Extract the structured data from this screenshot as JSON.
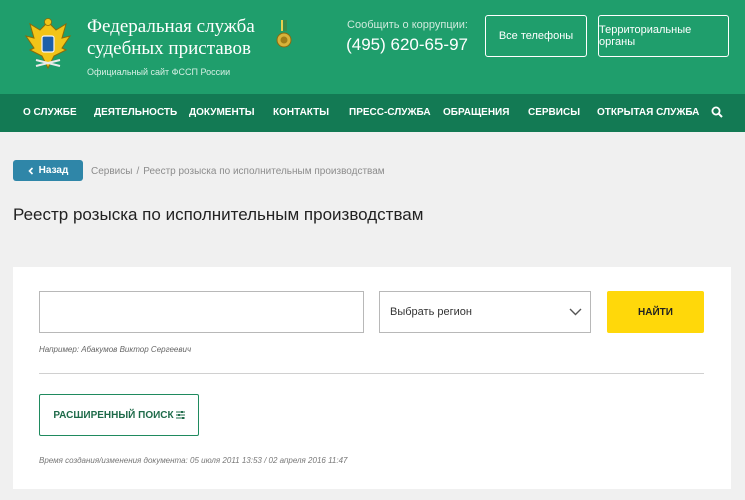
{
  "header": {
    "title_line1": "Федеральная служба",
    "title_line2": "судебных приставов",
    "subtitle": "Официальный сайт ФССП России",
    "corruption_label": "Сообщить о коррупции:",
    "corruption_phone": "(495) 620-65-97",
    "phones_button": "Все телефоны",
    "territorial_button": "Территориальные органы",
    "colors": {
      "primary": "#1f9e6c",
      "nav": "#137a54"
    }
  },
  "nav": {
    "items": [
      "О СЛУЖБЕ",
      "ДЕЯТЕЛЬНОСТЬ",
      "ДОКУМЕНТЫ",
      "КОНТАКТЫ",
      "ПРЕСС-СЛУЖБА",
      "ОБРАЩЕНИЯ",
      "СЕРВИСЫ",
      "ОТКРЫТАЯ СЛУЖБА"
    ],
    "search_icon": "search-icon"
  },
  "breadcrumb": {
    "back_label": "Назад",
    "items": [
      "Сервисы",
      "Реестр розыска по исполнительным производствам"
    ]
  },
  "page": {
    "title": "Реестр розыска по исполнительным производствам"
  },
  "search": {
    "name_value": "",
    "name_placeholder": "",
    "region_selected": "Выбрать регион",
    "find_label": "НАЙТИ",
    "hint": "Например: Абакумов Виктор Сергеевич",
    "advanced_label": "РАСШИРЕННЫЙ ПОИСК",
    "find_color": "#ffd80a"
  },
  "footer": {
    "doc_time": "Время создания/изменения документа: 05 июля 2011 13:53 / 02 апреля 2016 11:47"
  }
}
